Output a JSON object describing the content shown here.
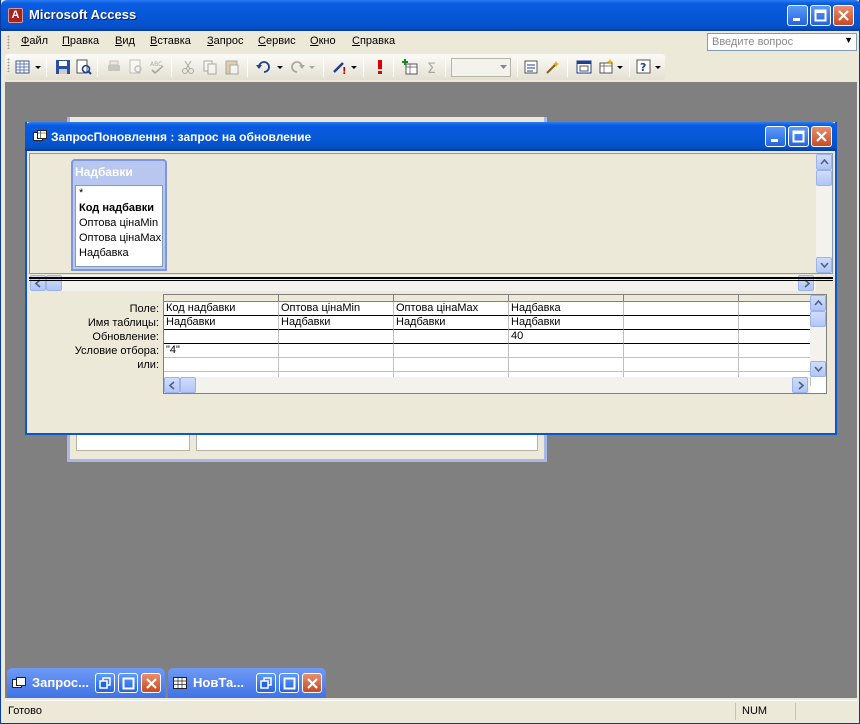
{
  "app": {
    "title": "Microsoft Access",
    "icon": "access-key-icon"
  },
  "menu": {
    "items": [
      {
        "label": "Файл",
        "accel": "Ф",
        "rest": "айл"
      },
      {
        "label": "Правка",
        "accel": "П",
        "rest": "равка"
      },
      {
        "label": "Вид",
        "accel": "В",
        "rest": "ид"
      },
      {
        "label": "Вставка",
        "accel": "В",
        "rest": "ставка"
      },
      {
        "label": "Запрос",
        "accel": "З",
        "rest": "апрос"
      },
      {
        "label": "Сервис",
        "accel": "С",
        "rest": "ервис"
      },
      {
        "label": "Окно",
        "accel": "О",
        "rest": "кно"
      },
      {
        "label": "Справка",
        "accel": "С",
        "rest": "правка"
      }
    ],
    "ask_placeholder": "Введите вопрос"
  },
  "query_window": {
    "title": "ЗапросПоновлення : запрос на обновление",
    "field_list": {
      "title": "Надбавки",
      "fields": [
        "*",
        "Код надбавки",
        "Оптова цінаMin",
        "Оптова цінаMax",
        "Надбавка"
      ]
    },
    "grid": {
      "row_labels": [
        "Поле:",
        "Имя таблицы:",
        "Обновление:",
        "Условие отбора:",
        "или:"
      ],
      "columns": [
        {
          "field": "Код надбавки",
          "table": "Надбавки",
          "update": "",
          "criteria": "\"4\"",
          "or": ""
        },
        {
          "field": "Оптова цінаMin",
          "table": "Надбавки",
          "update": "",
          "criteria": "",
          "or": ""
        },
        {
          "field": "Оптова цінаMax",
          "table": "Надбавки",
          "update": "",
          "criteria": "",
          "or": ""
        },
        {
          "field": "Надбавка",
          "table": "Надбавки",
          "update": "40",
          "criteria": "",
          "or": ""
        },
        {
          "field": "",
          "table": "",
          "update": "",
          "criteria": "",
          "or": ""
        },
        {
          "field": "",
          "table": "",
          "update": "",
          "criteria": "",
          "or": ""
        }
      ]
    }
  },
  "minimized_windows": [
    {
      "label": "Запрос...",
      "icon": "query-icon"
    },
    {
      "label": "НовТа...",
      "icon": "table-icon"
    }
  ],
  "status": {
    "text": "Готово",
    "num": "NUM"
  }
}
